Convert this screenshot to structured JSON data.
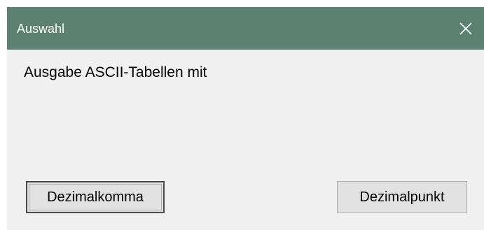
{
  "window": {
    "title": "Auswahl",
    "title_bar_color": "#5c8072",
    "close_icon": "close-icon"
  },
  "dialog": {
    "message": "Ausgabe ASCII-Tabellen mit"
  },
  "buttons": {
    "comma_label": "Dezimalkomma",
    "point_label": "Dezimalpunkt"
  }
}
